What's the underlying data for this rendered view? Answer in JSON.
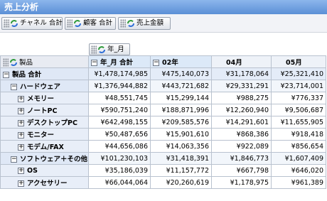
{
  "window": {
    "title": "売上分析"
  },
  "filters": [
    {
      "label": "チャネル 合計",
      "icon": "refresh-icon"
    },
    {
      "label": "顧客 合計",
      "icon": "refresh-icon"
    },
    {
      "label": "売上金額",
      "icon": "refresh-icon"
    }
  ],
  "column_dimension": {
    "label": "年_月",
    "icon": "refresh-icon"
  },
  "row_dimension": {
    "label": "製品",
    "icon": "refresh-icon"
  },
  "columns": [
    {
      "label": "年_月 合計",
      "toggle": "−"
    },
    {
      "label": "02年",
      "toggle": "−"
    },
    {
      "label": "04月"
    },
    {
      "label": "05月"
    }
  ],
  "rows": [
    {
      "label": "製品 合計",
      "toggle": "−",
      "values": [
        "¥1,478,174,985",
        "¥475,140,073",
        "¥31,178,064",
        "¥25,321,410"
      ]
    },
    {
      "label": "ハードウェア",
      "toggle": "−",
      "values": [
        "¥1,376,944,882",
        "¥443,721,682",
        "¥29,331,291",
        "¥23,714,001"
      ]
    },
    {
      "label": "メモリー",
      "toggle": "+",
      "values": [
        "¥48,551,745",
        "¥15,299,144",
        "¥988,275",
        "¥776,337"
      ]
    },
    {
      "label": "ノートPC",
      "toggle": "+",
      "values": [
        "¥590,751,240",
        "¥188,871,996",
        "¥12,260,940",
        "¥9,506,687"
      ]
    },
    {
      "label": "デスクトップPC",
      "toggle": "+",
      "values": [
        "¥642,498,155",
        "¥209,585,576",
        "¥14,291,601",
        "¥11,655,905"
      ]
    },
    {
      "label": "モニター",
      "toggle": "+",
      "values": [
        "¥50,487,656",
        "¥15,901,610",
        "¥868,386",
        "¥918,418"
      ]
    },
    {
      "label": "モデム/FAX",
      "toggle": "+",
      "values": [
        "¥44,656,086",
        "¥14,063,356",
        "¥922,089",
        "¥856,654"
      ]
    },
    {
      "label": "ソフトウェア＋その他",
      "toggle": "−",
      "values": [
        "¥101,230,103",
        "¥31,418,391",
        "¥1,846,773",
        "¥1,607,409"
      ]
    },
    {
      "label": "OS",
      "toggle": "+",
      "values": [
        "¥35,186,039",
        "¥11,157,772",
        "¥667,798",
        "¥646,020"
      ]
    },
    {
      "label": "アクセサリー",
      "toggle": "+",
      "values": [
        "¥66,044,064",
        "¥20,260,619",
        "¥1,178,975",
        "¥961,389"
      ]
    }
  ]
}
